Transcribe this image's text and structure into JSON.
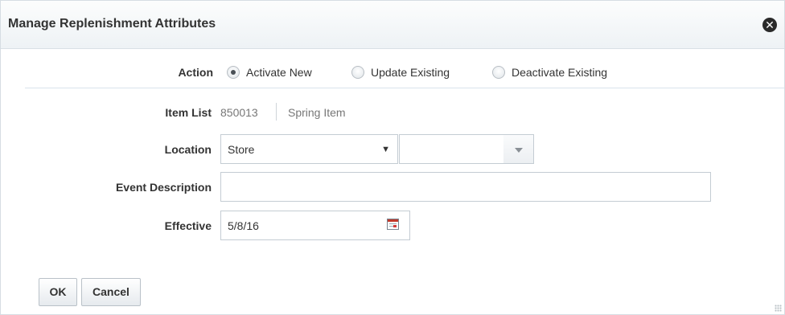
{
  "dialog": {
    "title": "Manage Replenishment Attributes",
    "close_icon": "close-icon"
  },
  "form": {
    "action": {
      "label": "Action",
      "options": [
        "Activate New",
        "Update Existing",
        "Deactivate Existing"
      ],
      "selected": "Activate New"
    },
    "item_list": {
      "label": "Item List",
      "id": "850013",
      "name": "Spring Item"
    },
    "location": {
      "label": "Location",
      "type_value": "Store",
      "value": ""
    },
    "event_description": {
      "label": "Event Description",
      "value": ""
    },
    "effective": {
      "label": "Effective",
      "value": "5/8/16",
      "calendar_icon": "calendar-icon"
    }
  },
  "buttons": {
    "ok": "OK",
    "cancel": "Cancel"
  }
}
